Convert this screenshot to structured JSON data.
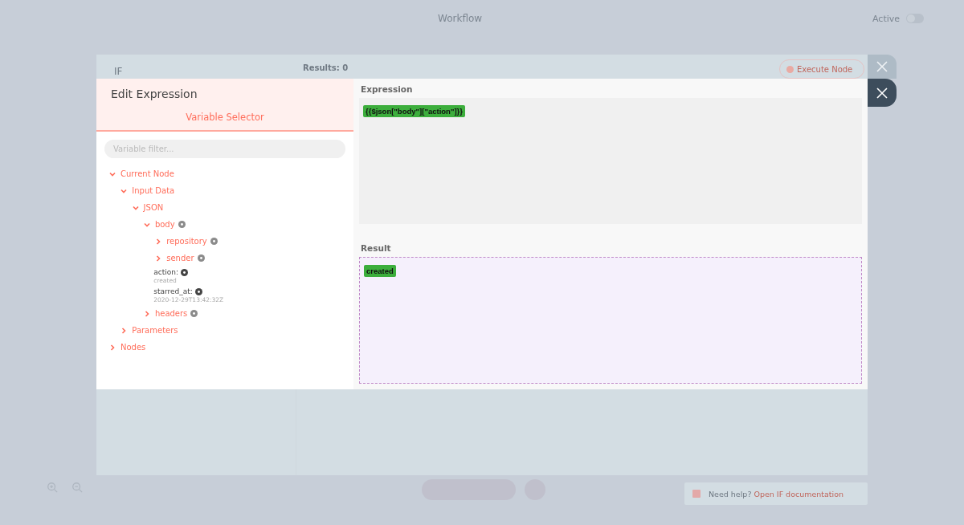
{
  "header": {
    "title": "Workflow",
    "active_label": "Active",
    "active": false
  },
  "node_dialog": {
    "title": "IF",
    "results": "Results: 0",
    "execute_button": "Execute Node"
  },
  "editor": {
    "title": "Edit Expression",
    "tab": "Variable Selector",
    "filter": {
      "placeholder": "Variable filter..."
    },
    "tree": [
      {
        "kind": "branch",
        "label": "Current Node",
        "expanded": true,
        "addable": false,
        "children": [
          {
            "kind": "branch",
            "label": "Input Data",
            "expanded": true,
            "addable": false,
            "children": [
              {
                "kind": "branch",
                "label": "JSON",
                "expanded": true,
                "addable": false,
                "children": [
                  {
                    "kind": "branch",
                    "label": "body",
                    "expanded": true,
                    "addable": true,
                    "children": [
                      {
                        "kind": "branch",
                        "label": "repository",
                        "expanded": false,
                        "addable": true
                      },
                      {
                        "kind": "branch",
                        "label": "sender",
                        "expanded": false,
                        "addable": true
                      },
                      {
                        "kind": "leaf",
                        "label": "action:",
                        "value": "created",
                        "addable": true
                      },
                      {
                        "kind": "leaf",
                        "label": "starred_at:",
                        "value": "2020-12-29T13:42:32Z",
                        "addable": true
                      }
                    ]
                  },
                  {
                    "kind": "branch",
                    "label": "headers",
                    "expanded": false,
                    "addable": true
                  }
                ]
              }
            ]
          },
          {
            "kind": "branch",
            "label": "Parameters",
            "expanded": false,
            "addable": false
          }
        ]
      },
      {
        "kind": "branch",
        "label": "Nodes",
        "expanded": false,
        "addable": false
      }
    ],
    "expression_label": "Expression",
    "expression": "{{$json[\"body\"][\"action\"]}}",
    "result_label": "Result",
    "result": "created"
  },
  "help": {
    "text": "Need help?",
    "link": "Open IF documentation"
  }
}
